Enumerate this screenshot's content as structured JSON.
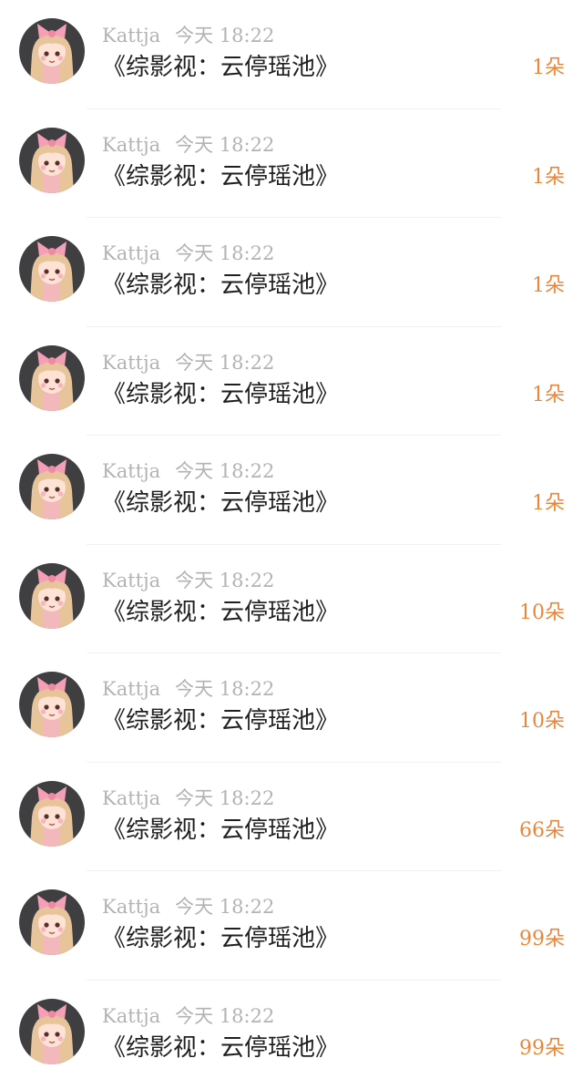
{
  "colors": {
    "username": "#b3b3b3",
    "title": "#1f1f1f",
    "amount": "#e8873c",
    "avatar_bg": "#3f3f42"
  },
  "rows": [
    {
      "username": "Kattja",
      "time": "今天 18:22",
      "title": "《综影视：云停瑶池》",
      "amount": "1朵",
      "avatar_icon": "girl-with-pink-bow-avatar"
    },
    {
      "username": "Kattja",
      "time": "今天 18:22",
      "title": "《综影视：云停瑶池》",
      "amount": "1朵",
      "avatar_icon": "girl-with-pink-bow-avatar"
    },
    {
      "username": "Kattja",
      "time": "今天 18:22",
      "title": "《综影视：云停瑶池》",
      "amount": "1朵",
      "avatar_icon": "girl-with-pink-bow-avatar"
    },
    {
      "username": "Kattja",
      "time": "今天 18:22",
      "title": "《综影视：云停瑶池》",
      "amount": "1朵",
      "avatar_icon": "girl-with-pink-bow-avatar"
    },
    {
      "username": "Kattja",
      "time": "今天 18:22",
      "title": "《综影视：云停瑶池》",
      "amount": "1朵",
      "avatar_icon": "girl-with-pink-bow-avatar"
    },
    {
      "username": "Kattja",
      "time": "今天 18:22",
      "title": "《综影视：云停瑶池》",
      "amount": "10朵",
      "avatar_icon": "girl-with-pink-bow-avatar"
    },
    {
      "username": "Kattja",
      "time": "今天 18:22",
      "title": "《综影视：云停瑶池》",
      "amount": "10朵",
      "avatar_icon": "girl-with-pink-bow-avatar"
    },
    {
      "username": "Kattja",
      "time": "今天 18:22",
      "title": "《综影视：云停瑶池》",
      "amount": "66朵",
      "avatar_icon": "girl-with-pink-bow-avatar"
    },
    {
      "username": "Kattja",
      "time": "今天 18:22",
      "title": "《综影视：云停瑶池》",
      "amount": "99朵",
      "avatar_icon": "girl-with-pink-bow-avatar"
    },
    {
      "username": "Kattja",
      "time": "今天 18:22",
      "title": "《综影视：云停瑶池》",
      "amount": "99朵",
      "avatar_icon": "girl-with-pink-bow-avatar"
    }
  ]
}
